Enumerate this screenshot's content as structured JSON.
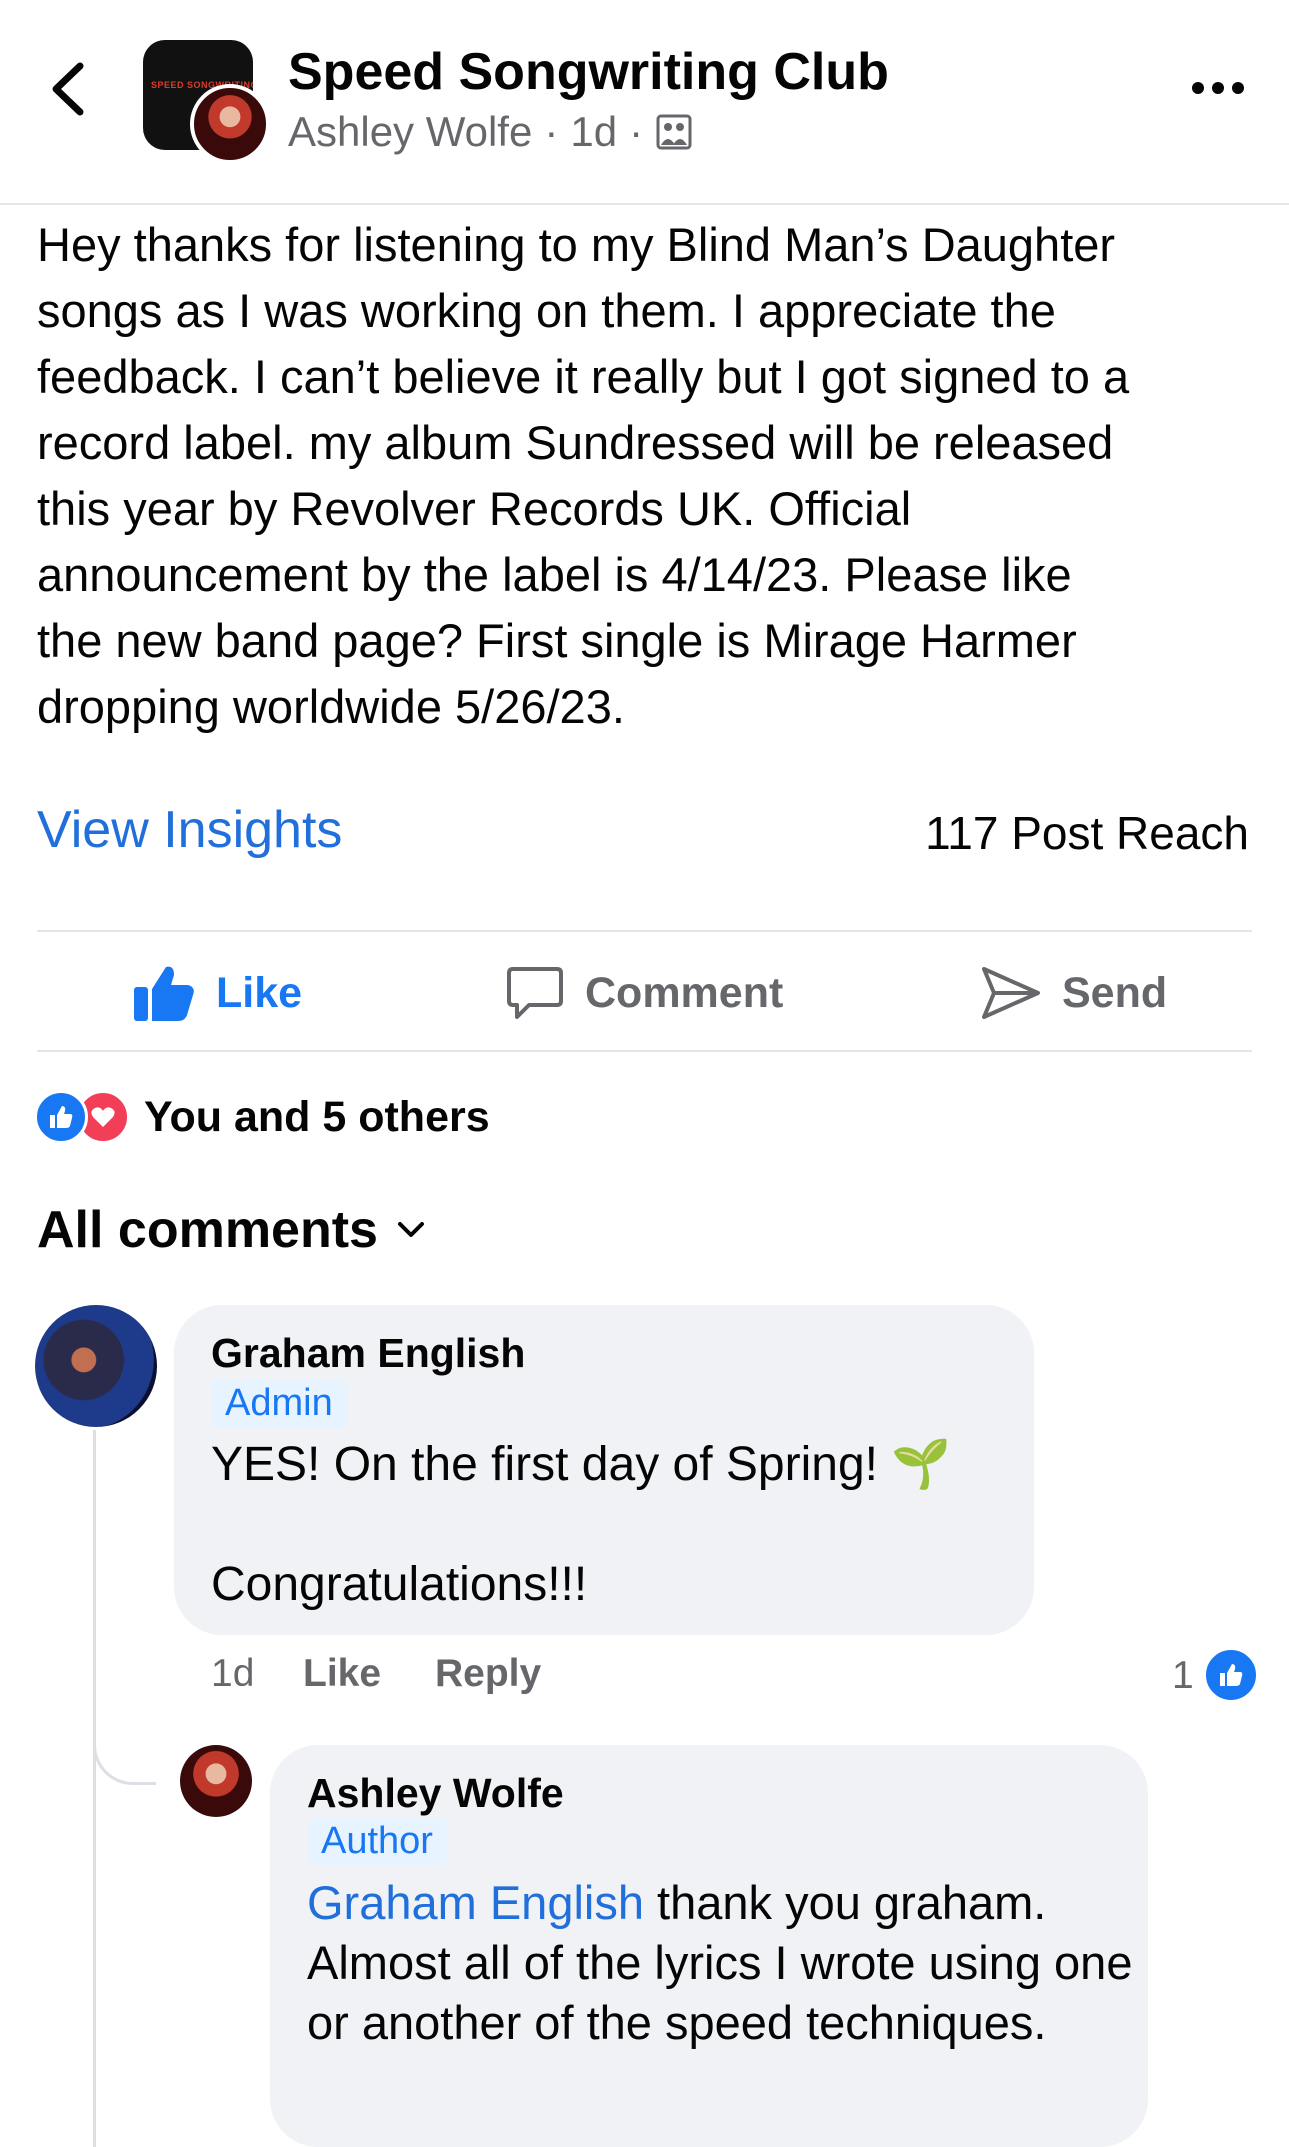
{
  "header": {
    "group_name": "Speed Songwriting Club",
    "author": "Ashley Wolfe",
    "separator": "·",
    "time": "1d",
    "avatar_brand": "SPEED SONGWRITING",
    "privacy_icon": "group-audience-icon"
  },
  "post": {
    "text": "Hey thanks for listening to my Blind Man’s Daughter\nsongs as I was working on them. I appreciate the\nfeedback.  I can’t believe it really but I got signed to a\nrecord label.  my album Sundressed will be released\nthis year by Revolver Records UK.  Official\nannouncement by the label is 4/14/23.  Please like\nthe new band page?  First single is Mirage Harmer\ndropping worldwide 5/26/23.",
    "view_insights": "View Insights",
    "post_reach": "117 Post Reach"
  },
  "actions": {
    "like": "Like",
    "comment": "Comment",
    "send": "Send"
  },
  "reactions": {
    "summary": "You and 5 others",
    "icons": [
      "like-reaction-icon",
      "love-reaction-icon"
    ]
  },
  "comments_header": {
    "label": "All comments"
  },
  "comments": [
    {
      "name": "Graham English",
      "badge": "Admin",
      "text": "YES! On the first day of Spring! 🌱\n\nCongratulations!!!",
      "time": "1d",
      "like": "Like",
      "reply": "Reply",
      "reaction_count": "1"
    },
    {
      "name": "Ashley Wolfe",
      "badge": "Author",
      "mention": "Graham English",
      "text": " thank you graham. Almost all of the lyrics I wrote using one or another of the speed techniques."
    }
  ],
  "colors": {
    "link_blue": "#216fdb",
    "facebook_blue": "#1877f2",
    "secondary_text": "#65676b",
    "bubble_bg": "#f0f2f5",
    "love_red": "#f33e58"
  }
}
